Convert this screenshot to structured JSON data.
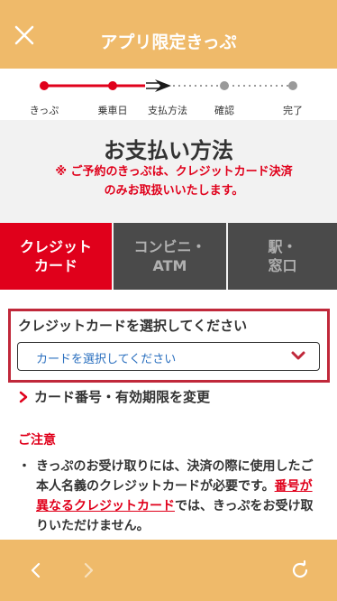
{
  "header": {
    "title": "アプリ限定きっぷ",
    "close_icon": "close-icon"
  },
  "steps": {
    "items": [
      {
        "label": "きっぷ",
        "state": "completed"
      },
      {
        "label": "乗車日",
        "state": "completed"
      },
      {
        "label": "支払方法",
        "state": "current"
      },
      {
        "label": "確認",
        "state": "pending"
      },
      {
        "label": "完了",
        "state": "pending"
      }
    ],
    "current_icon": "train-arrow-icon"
  },
  "page": {
    "title": "お支払い方法",
    "notice_line1": "※ ご予約のきっぷは、クレジットカード決済",
    "notice_line2": "のみお取扱いいたします。"
  },
  "tabs": [
    {
      "label": "クレジット\nカード",
      "active": true
    },
    {
      "label": "コンビニ・\nATM",
      "active": false
    },
    {
      "label": "駅・\n窓口",
      "active": false
    }
  ],
  "card_select": {
    "label": "クレジットカードを選択してください",
    "value": "カードを選択してください",
    "caret_icon": "chevron-down-icon"
  },
  "change_link": {
    "label": "カード番号・有効期限を変更",
    "icon": "chevron-right-icon"
  },
  "caution": {
    "title": "ご注意",
    "bullet": "・",
    "text_before": "きっぷのお受け取りには、決済の際に使用したご本人名義のクレジットカードが必要です。",
    "text_link": "番号が異なるクレジットカード",
    "text_after": "では、きっぷをお受け取りいただけません。"
  },
  "footer": {
    "back_icon": "chevron-left-icon",
    "forward_icon": "chevron-right-icon",
    "reload_icon": "reload-icon"
  },
  "colors": {
    "accent": "#efba6a",
    "brand_red": "#e0001b",
    "tab_inactive": "#4a4a4a",
    "link_blue": "#2a6fbf"
  }
}
